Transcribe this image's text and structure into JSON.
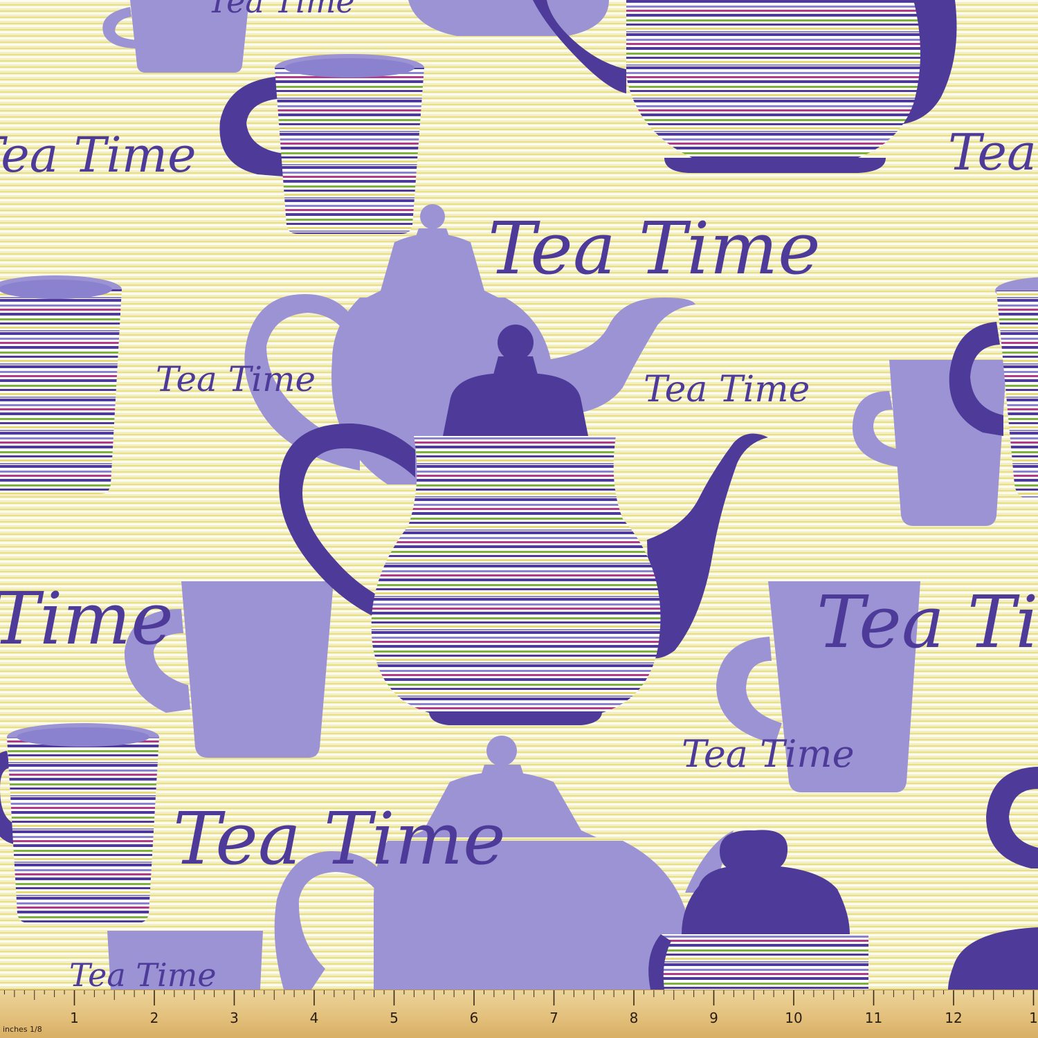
{
  "motif_text": "Tea Time",
  "palette": {
    "background": "#f4efc2",
    "stripe_yellow": "#e2d66a",
    "lavender": "#9b93d3",
    "indigo": "#4d3a99",
    "stripe_colors": [
      "#4d3a99",
      "#8b82cf",
      "#b23a87",
      "#7fb239",
      "#ffffff",
      "#e6dc73"
    ]
  },
  "ruler": {
    "unit_label": "inches 1/8",
    "numbers": [
      "1",
      "2",
      "3",
      "4",
      "5",
      "6",
      "7",
      "8",
      "9",
      "10",
      "11",
      "12",
      "1"
    ]
  }
}
